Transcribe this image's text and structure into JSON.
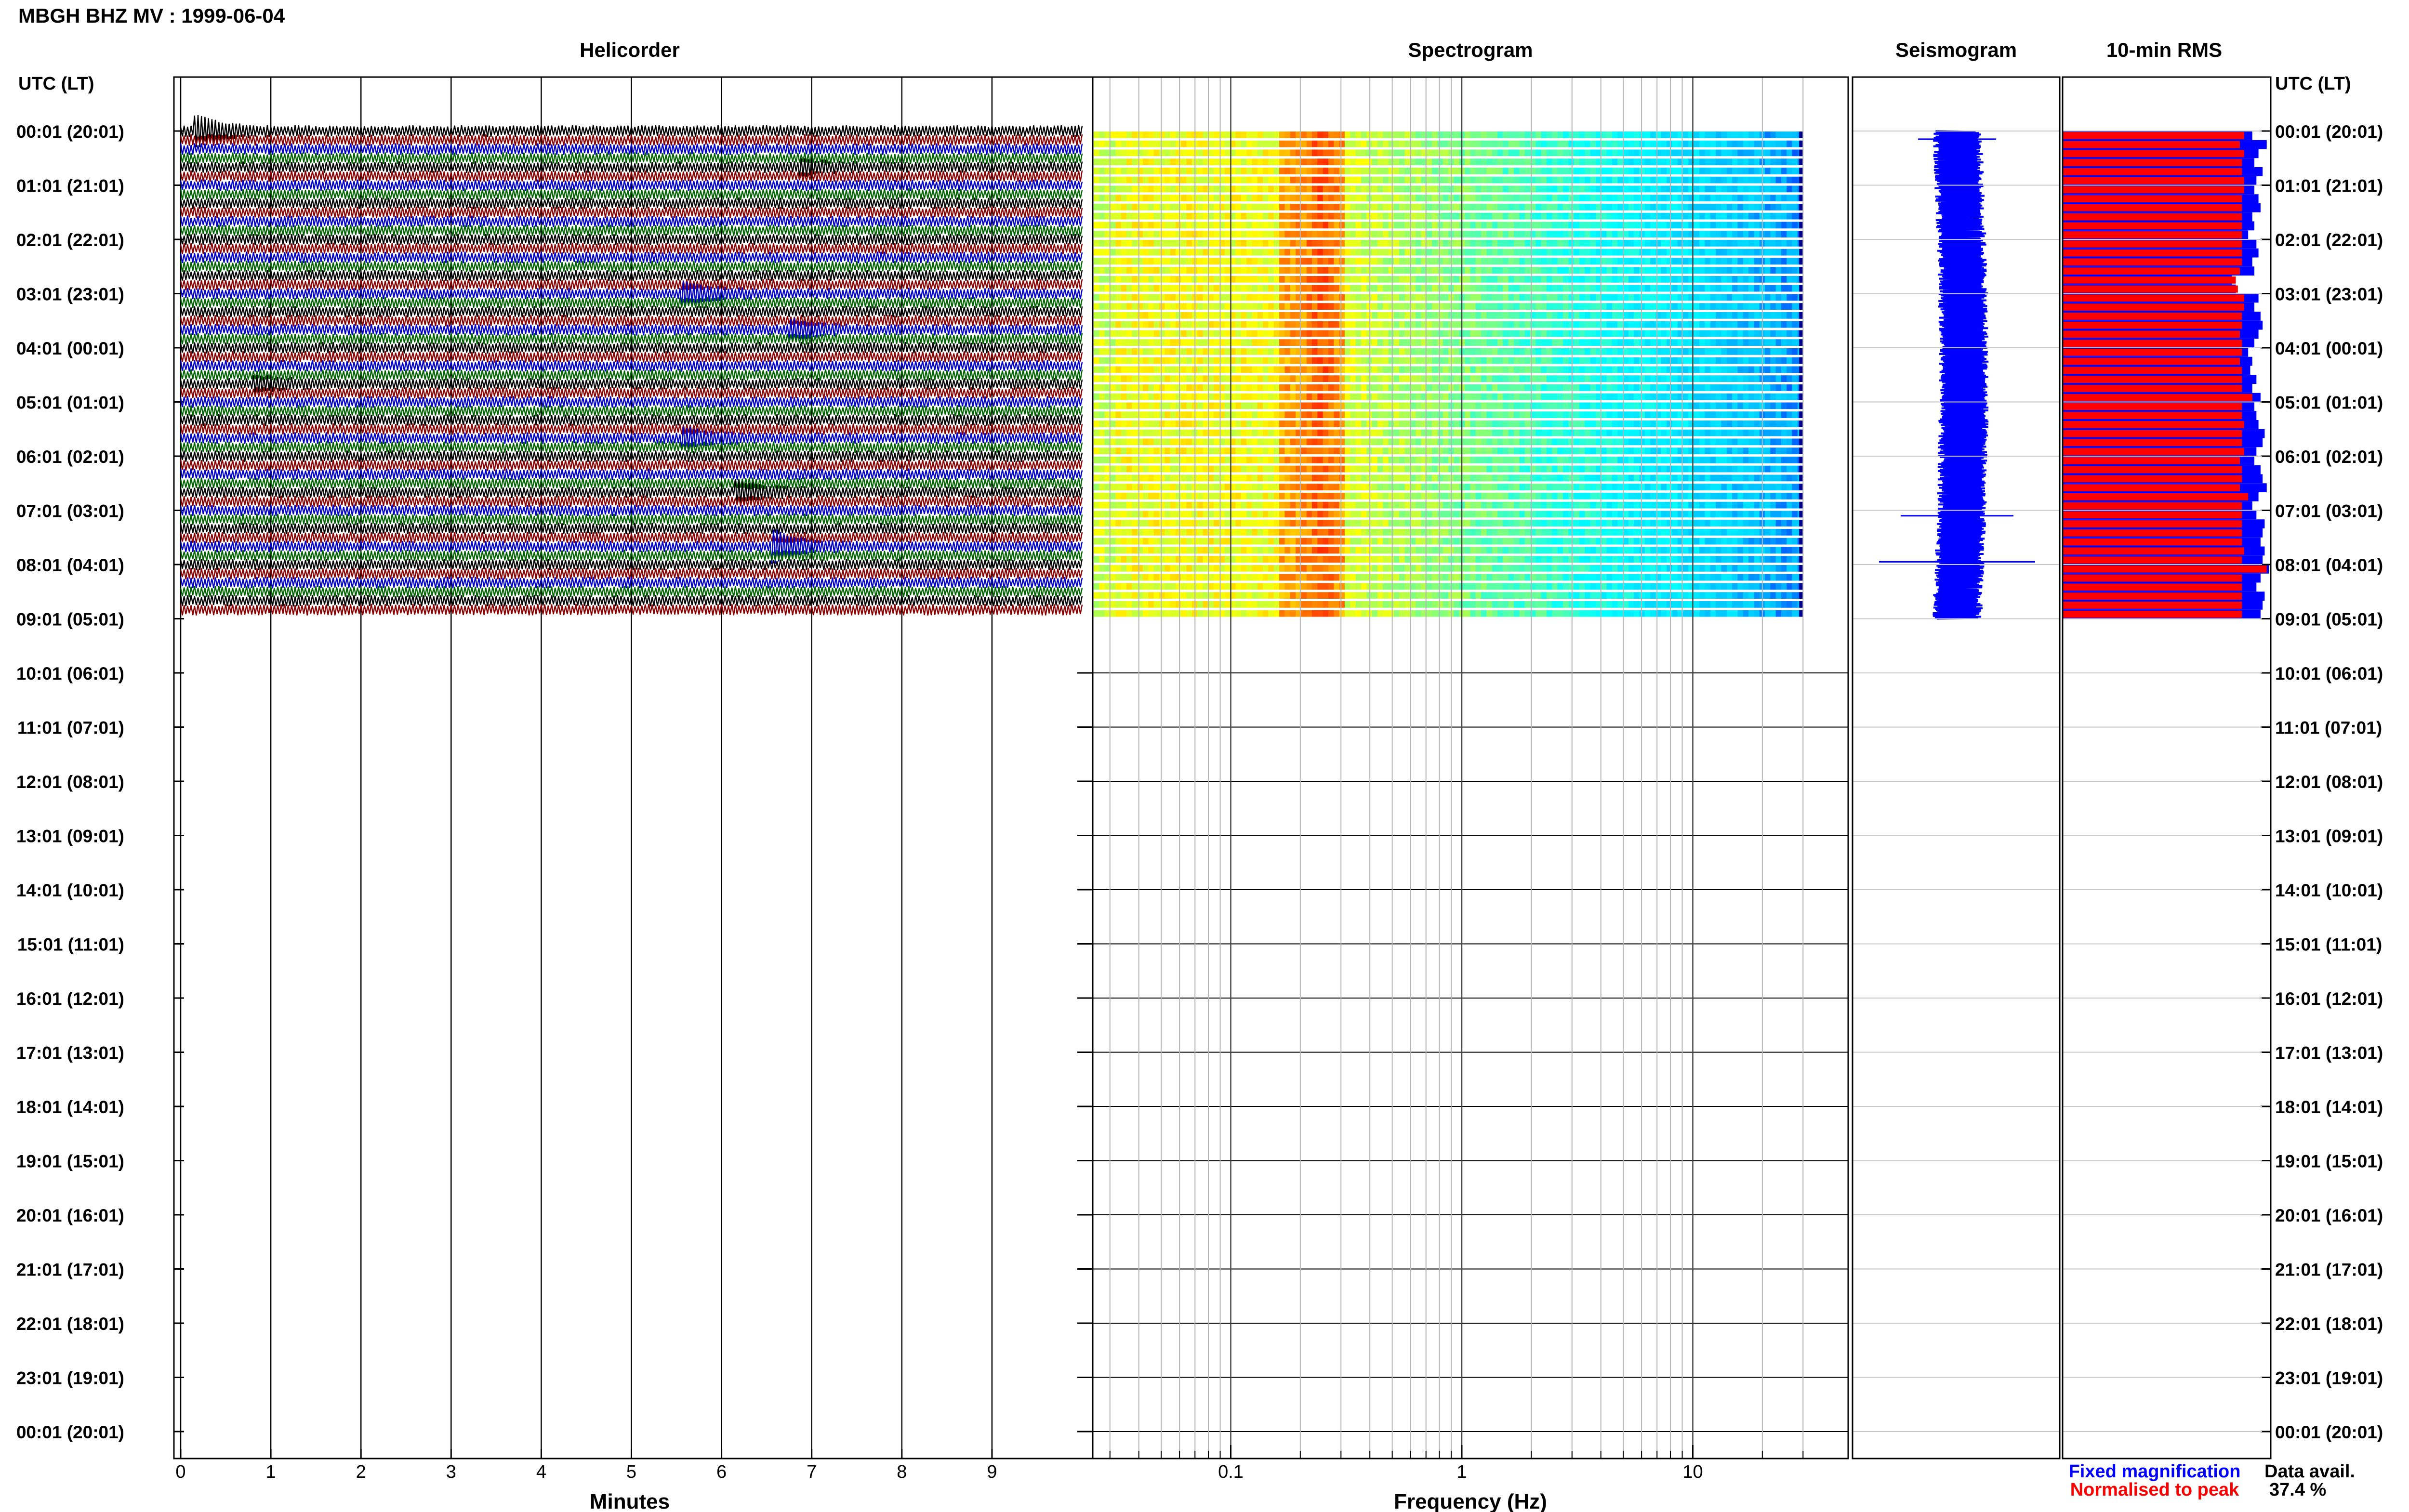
{
  "title": "MBGH BHZ MV : 1999-06-04",
  "time_header_left": "UTC (LT)",
  "time_header_right": "UTC (LT)",
  "time_labels": [
    "00:01 (20:01)",
    "01:01 (21:01)",
    "02:01 (22:01)",
    "03:01 (23:01)",
    "04:01 (00:01)",
    "05:01 (01:01)",
    "06:01 (02:01)",
    "07:01 (03:01)",
    "08:01 (04:01)",
    "09:01 (05:01)",
    "10:01 (06:01)",
    "11:01 (07:01)",
    "12:01 (08:01)",
    "13:01 (09:01)",
    "14:01 (10:01)",
    "15:01 (11:01)",
    "16:01 (12:01)",
    "17:01 (13:01)",
    "18:01 (14:01)",
    "19:01 (15:01)",
    "20:01 (16:01)",
    "21:01 (17:01)",
    "22:01 (18:01)",
    "23:01 (19:01)",
    "00:01 (20:01)"
  ],
  "legend": {
    "fixed": "Fixed magnification",
    "fixed_color": "#0000ff",
    "normalised": "Normalised to peak",
    "normalised_color": "#ff0000",
    "data_avail_label": "Data avail.",
    "data_avail_value": "37.4 %"
  },
  "chart_data": [
    {
      "type": "line",
      "panel": "helicorder",
      "title": "Helicorder",
      "xlabel": "Minutes",
      "x_ticks": [
        "0",
        "1",
        "2",
        "3",
        "4",
        "5",
        "6",
        "7",
        "8",
        "9"
      ],
      "xlim": [
        0,
        10
      ],
      "ylim_hours": [
        0,
        24
      ],
      "rows_with_data": 54,
      "trace_colors": [
        "#000000",
        "#8b0000",
        "#0000cd",
        "#006400"
      ],
      "events": [
        {
          "row": 0,
          "minute": 0.2,
          "amp": 2.5
        },
        {
          "row": 4,
          "minute": 6.9,
          "amp": 1.0
        },
        {
          "row": 18,
          "minute": 5.6,
          "amp": 1.6
        },
        {
          "row": 22,
          "minute": 6.8,
          "amp": 1.4
        },
        {
          "row": 28,
          "minute": 0.85,
          "amp": 1.0
        },
        {
          "row": 34,
          "minute": 5.6,
          "amp": 1.5
        },
        {
          "row": 40,
          "minute": 6.2,
          "amp": 1.6
        },
        {
          "row": 46,
          "minute": 6.6,
          "amp": 2.5
        }
      ]
    },
    {
      "type": "heatmap",
      "panel": "spectrogram",
      "title": "Spectrogram",
      "xlabel": "Frequency (Hz)",
      "x_ticks": [
        "0.1",
        "1",
        "10"
      ],
      "x_scale": "log",
      "xlim": [
        0.025,
        40
      ],
      "data_fmax": 30,
      "peak_band_hz": [
        0.2,
        0.3
      ],
      "ylim_hours": [
        0,
        24
      ],
      "rows_with_data": 54,
      "colormap": [
        "#00008b",
        "#0000ff",
        "#00bfff",
        "#00ffff",
        "#7fff7f",
        "#ffff00",
        "#ff7f00",
        "#ff0000"
      ]
    },
    {
      "type": "line",
      "panel": "seismogram",
      "title": "Seismogram",
      "ylim_hours": [
        0,
        24
      ],
      "color": "#0000ff",
      "data_hours": [
        0,
        9
      ],
      "spikes": [
        {
          "hour": 0.15,
          "amp": 0.9
        },
        {
          "hour": 7.1,
          "amp": 1.3
        },
        {
          "hour": 7.95,
          "amp": 1.8
        }
      ]
    },
    {
      "type": "bar",
      "panel": "rms",
      "title": "10-min RMS",
      "ylim_hours": [
        0,
        24
      ],
      "bin_minutes": 10,
      "series": [
        {
          "name": "Fixed magnification",
          "color": "#0000ff"
        },
        {
          "name": "Normalised to peak",
          "color": "#ff0000"
        }
      ],
      "fixed_values": [
        0.92,
        0.99,
        0.95,
        0.93,
        0.97,
        0.94,
        0.93,
        0.95,
        0.96,
        0.92,
        0.93,
        0.9,
        0.94,
        0.95,
        0.92,
        0.93,
        0.82,
        0.84,
        0.95,
        0.93,
        0.96,
        0.97,
        0.95,
        0.93,
        0.9,
        0.92,
        0.91,
        0.94,
        0.92,
        0.96,
        0.93,
        0.94,
        0.95,
        0.98,
        0.97,
        0.94,
        0.93,
        0.96,
        0.97,
        0.99,
        0.95,
        0.92,
        0.94,
        0.98,
        0.97,
        0.96,
        0.98,
        0.97,
        1.0,
        0.96,
        0.94,
        0.98,
        0.97,
        0.96
      ],
      "normalised_values": [
        0.88,
        0.86,
        0.88,
        0.87,
        0.87,
        0.88,
        0.88,
        0.87,
        0.87,
        0.87,
        0.87,
        0.87,
        0.87,
        0.87,
        0.87,
        0.86,
        0.84,
        0.85,
        0.88,
        0.88,
        0.87,
        0.87,
        0.86,
        0.87,
        0.87,
        0.86,
        0.87,
        0.87,
        0.87,
        0.92,
        0.87,
        0.87,
        0.88,
        0.87,
        0.87,
        0.88,
        0.86,
        0.87,
        0.87,
        0.86,
        0.9,
        0.87,
        0.87,
        0.87,
        0.87,
        0.87,
        0.88,
        0.87,
        0.99,
        0.87,
        0.87,
        0.87,
        0.87,
        0.87
      ]
    }
  ]
}
